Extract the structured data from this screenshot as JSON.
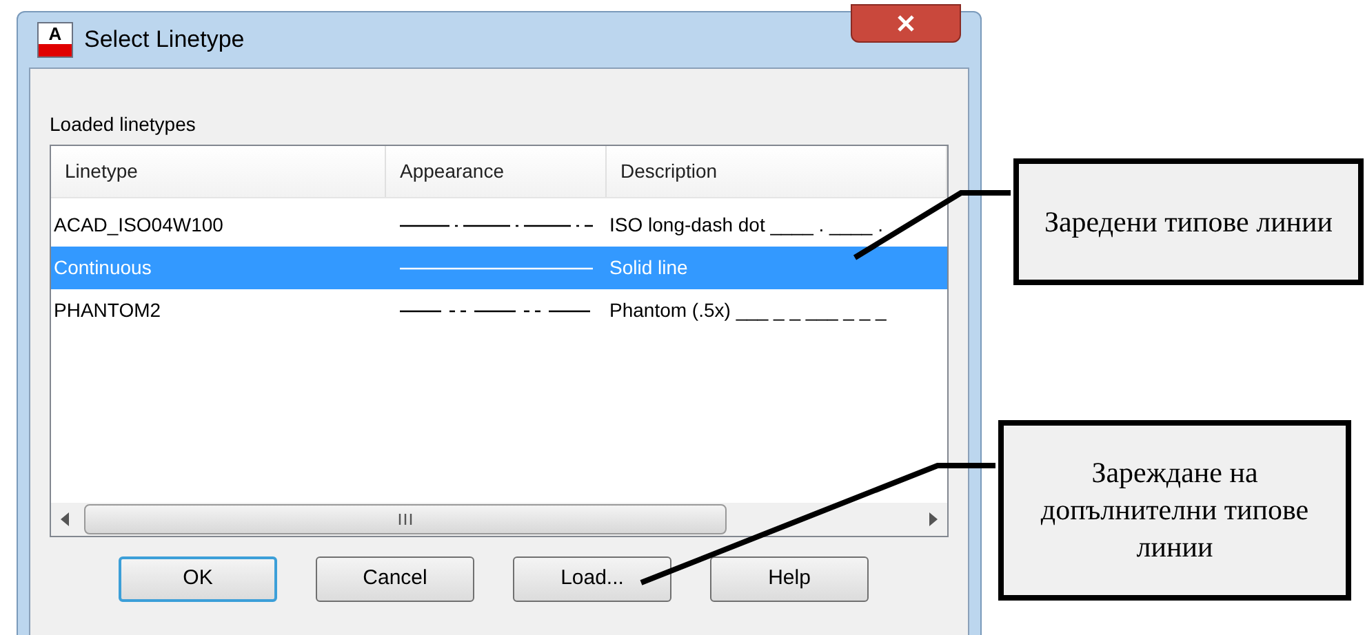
{
  "window": {
    "title": "Select Linetype",
    "icon_letter": "A"
  },
  "list": {
    "label": "Loaded linetypes",
    "columns": [
      "Linetype",
      "Appearance",
      "Description"
    ],
    "rows": [
      {
        "name": "ACAD_ISO04W100",
        "kind": "dash-dot",
        "description": "ISO long-dash dot ____ . ____ .",
        "selected": false
      },
      {
        "name": "Continuous",
        "kind": "solid",
        "description": "Solid line",
        "selected": true
      },
      {
        "name": "PHANTOM2",
        "kind": "phantom",
        "description": "Phantom (.5x) ___ _ _ ___ _ _ _",
        "selected": false
      }
    ]
  },
  "buttons": [
    {
      "label": "OK",
      "default": true
    },
    {
      "label": "Cancel",
      "default": false
    },
    {
      "label": "Load...",
      "default": false
    },
    {
      "label": "Help",
      "default": false
    }
  ],
  "callouts": [
    {
      "text": "Заредени типове линии"
    },
    {
      "text": "Зареждане на допълнителни типове линии"
    }
  ]
}
